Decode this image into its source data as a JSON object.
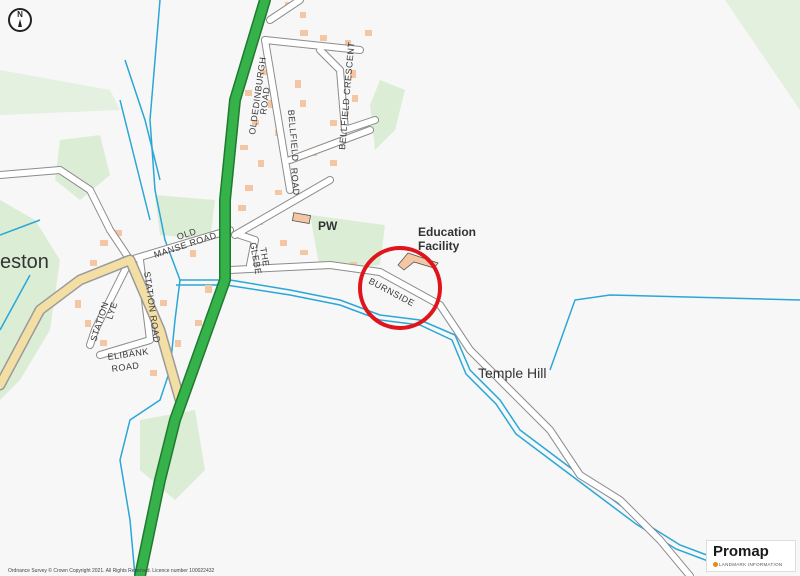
{
  "map": {
    "place_labels": {
      "village": "eston",
      "pw": "PW",
      "education_line1": "Education",
      "education_line2": "Facility",
      "temple_hill": "Temple Hill"
    },
    "road_labels": {
      "oldedinburgh_1": "OLDEDINBURGH",
      "oldedinburgh_2": "ROAD",
      "bellfield_crescent": "BELLFIELD CRESCENT",
      "bellfield_road_1": "BELLFIELD",
      "bellfield_road_2": "ROAD",
      "old_manse_1": "OLD",
      "old_manse_2": "MANSE ROAD",
      "the_glebe_1": "THE",
      "the_glebe_2": "GLEBE",
      "burnside": "BURNSIDE",
      "station_lye_1": "STATION",
      "station_lye_2": "LYE",
      "station_road": "STATION ROAD",
      "elibank_1": "ELIBANK",
      "elibank_2": "ROAD"
    },
    "north_arrow": "N",
    "colors": {
      "background": "#f7f7f7",
      "major_road": "#36b24a",
      "a_road": "#f3dfa4",
      "minor_road": "#b8b8b8",
      "water": "#2aa7d6",
      "woodland": "#d6ecd0",
      "building": "#f4c6a4",
      "site_marker": "#e0141b"
    }
  },
  "copyright": "Ordnance Survey © Crown Copyright 2021. All Rights Reserved. Licence number 100022432",
  "branding": {
    "name": "Promap",
    "tagline": "LANDMARK INFORMATION"
  }
}
